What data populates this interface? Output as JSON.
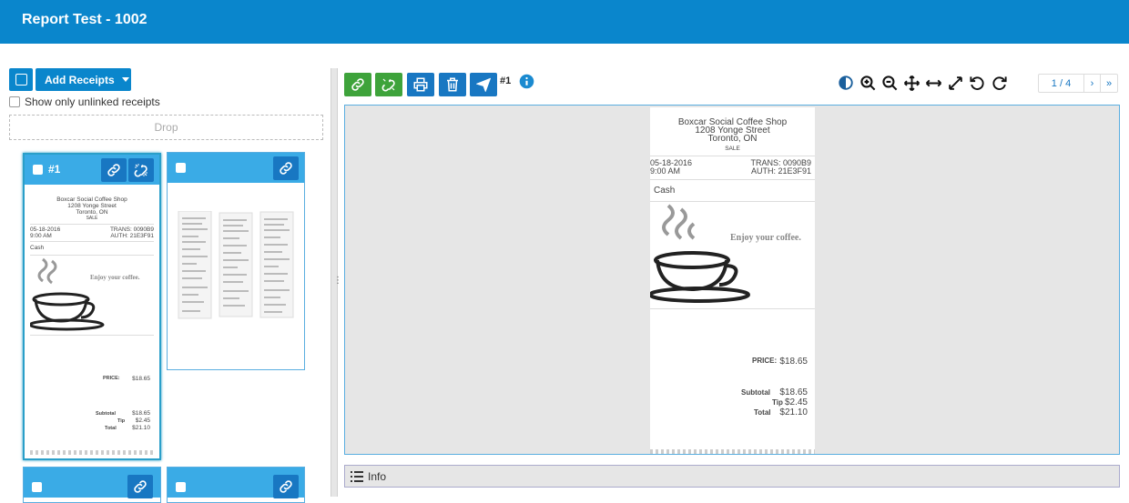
{
  "header": {
    "title": "Report Test - 1002"
  },
  "left": {
    "add_receipts_label": "Add Receipts",
    "show_unlinked_label": "Show only unlinked receipts",
    "drop_label": "Drop",
    "cards": [
      {
        "number": "#1",
        "selected": true
      },
      {
        "number": "",
        "selected": false
      },
      {
        "number": "",
        "selected": false
      },
      {
        "number": "",
        "selected": false
      }
    ]
  },
  "receipt": {
    "shop_name": "Boxcar Social Coffee Shop",
    "address": "1208 Yonge Street",
    "city": "Toronto, ON",
    "type": "SALE",
    "date": "05-18-2016",
    "time": "9:00 AM",
    "trans": "TRANS: 0090B9",
    "auth": "AUTH: 21E3F91",
    "payment": "Cash",
    "slogan": "Enjoy your coffee.",
    "price_label": "PRICE:",
    "price": "$18.65",
    "subtotal_label": "Subtotal",
    "subtotal": "$18.65",
    "tip_label": "Tip",
    "tip": "$2.45",
    "total_label": "Total",
    "total": "$21.10"
  },
  "viewer": {
    "receipt_number": "#1",
    "page_indicator": "1 / 4",
    "next_label": "›",
    "last_label": "»",
    "info_label": "Info"
  },
  "colors": {
    "primary": "#0a86cc",
    "link_green": "#3ea33b",
    "button_blue": "#1877c2"
  }
}
